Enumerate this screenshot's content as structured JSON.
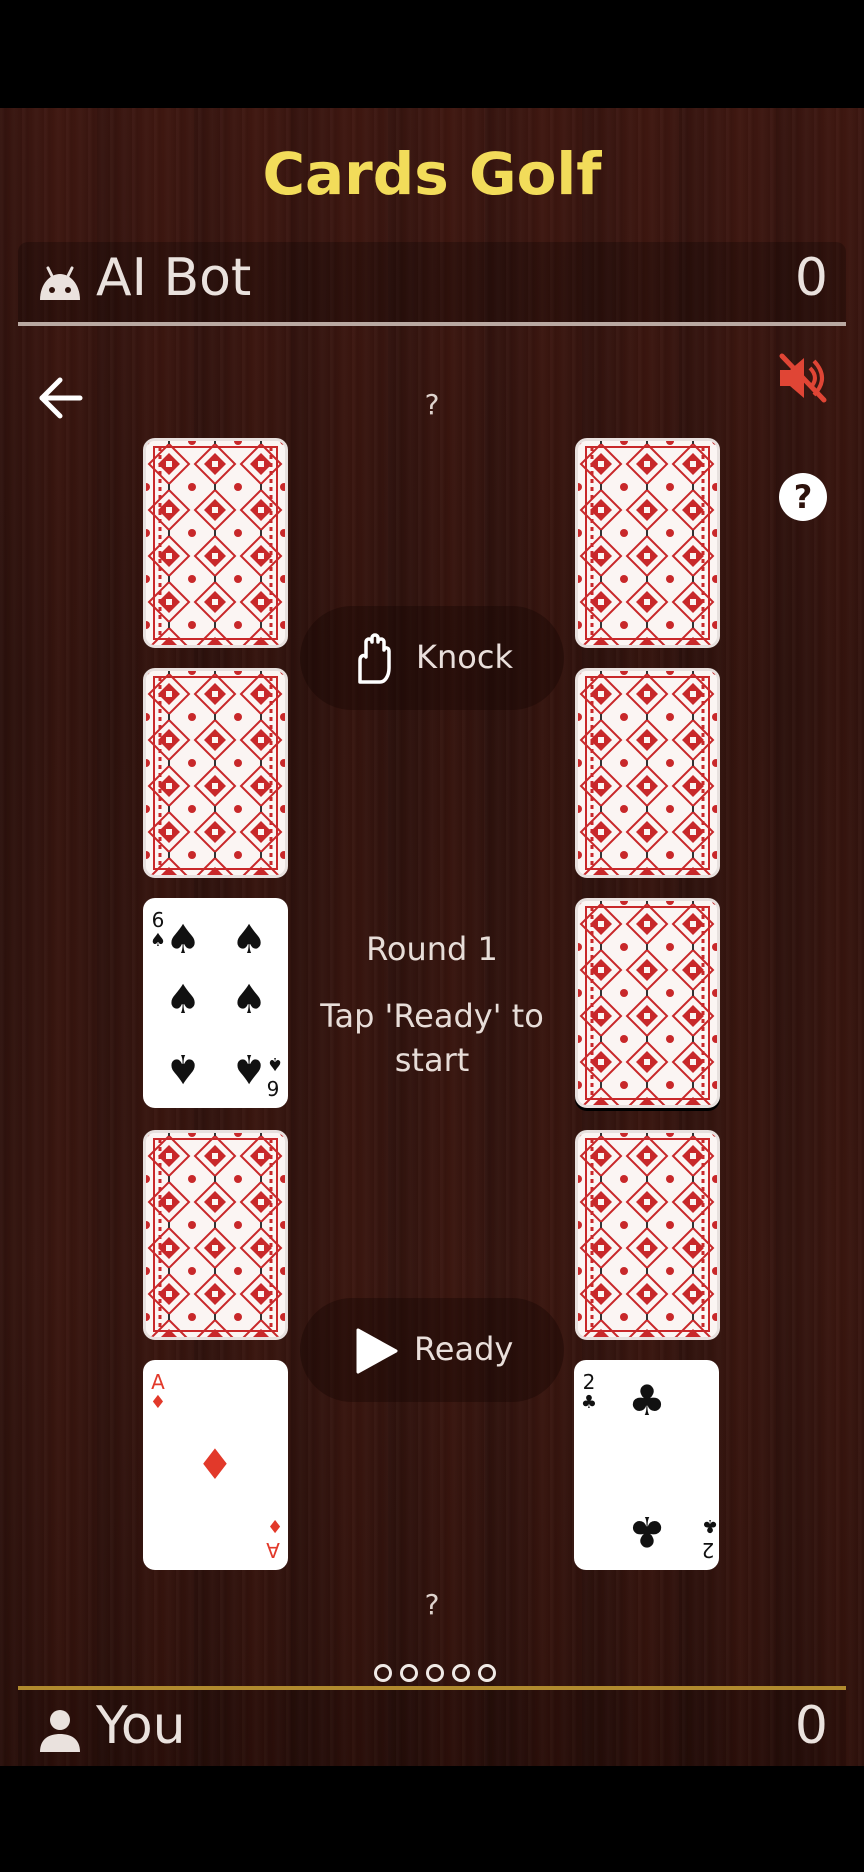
{
  "app": {
    "title": "Cards Golf"
  },
  "opponent": {
    "name": "AI Bot",
    "score": "0",
    "icon": "android-icon"
  },
  "player": {
    "name": "You",
    "score": "0",
    "icon": "person-icon"
  },
  "controls": {
    "back_icon": "arrow-left-icon",
    "mute_icon": "volume-off-icon",
    "help_icon": "help-circle-icon",
    "mute_color": "#e04535"
  },
  "piles": {
    "opponent_hidden": "?",
    "player_hidden": "?"
  },
  "actions": {
    "knock_label": "Knock",
    "ready_label": "Ready"
  },
  "status": {
    "round": "Round 1",
    "message": "Tap 'Ready' to start"
  },
  "cards": {
    "left_column": [
      {
        "state": "face-down"
      },
      {
        "state": "face-down"
      },
      {
        "state": "face-up",
        "rank": "6",
        "suit": "spades"
      },
      {
        "state": "face-down"
      },
      {
        "state": "face-up",
        "rank": "A",
        "suit": "diamonds"
      }
    ],
    "right_column": [
      {
        "state": "face-down"
      },
      {
        "state": "face-down"
      },
      {
        "state": "face-down"
      },
      {
        "state": "face-down"
      },
      {
        "state": "face-up",
        "rank": "2",
        "suit": "clubs"
      }
    ]
  },
  "page_indicator": {
    "count": 5
  },
  "colors": {
    "title": "#f2dc5a",
    "card_pattern": "#c8282a",
    "table": "#34140e"
  }
}
